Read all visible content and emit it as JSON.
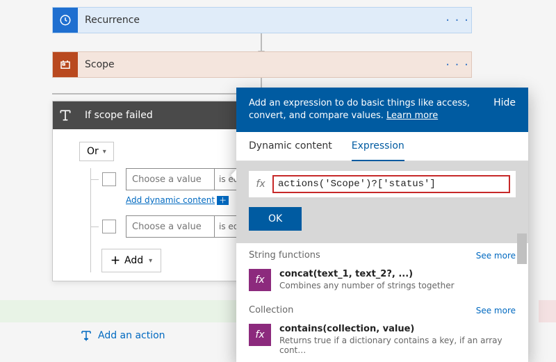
{
  "cards": {
    "recurrence": {
      "title": "Recurrence"
    },
    "scope": {
      "title": "Scope"
    }
  },
  "condition": {
    "title": "If scope failed",
    "group_op": "Or",
    "rows": [
      {
        "value_placeholder": "Choose a value",
        "op": "is eq"
      },
      {
        "value_placeholder": "Choose a value",
        "op": "is eq"
      }
    ],
    "add_dynamic_label": "Add dynamic content",
    "add_label": "Add"
  },
  "footer": {
    "add_action_label": "Add an action"
  },
  "panel": {
    "intro": "Add an expression to do basic things like access, convert, and compare values. ",
    "learn_more": "Learn more",
    "hide": "Hide",
    "tabs": {
      "dynamic": "Dynamic content",
      "expression": "Expression"
    },
    "fx": "fx",
    "expr_value": "actions('Scope')?['status']",
    "ok": "OK",
    "categories": [
      {
        "name": "String functions",
        "see_more": "See more",
        "item": {
          "sig": "concat(text_1, text_2?, ...)",
          "desc": "Combines any number of strings together"
        }
      },
      {
        "name": "Collection",
        "see_more": "See more",
        "item": {
          "sig": "contains(collection, value)",
          "desc": "Returns true if a dictionary contains a key, if an array cont…"
        }
      }
    ]
  }
}
